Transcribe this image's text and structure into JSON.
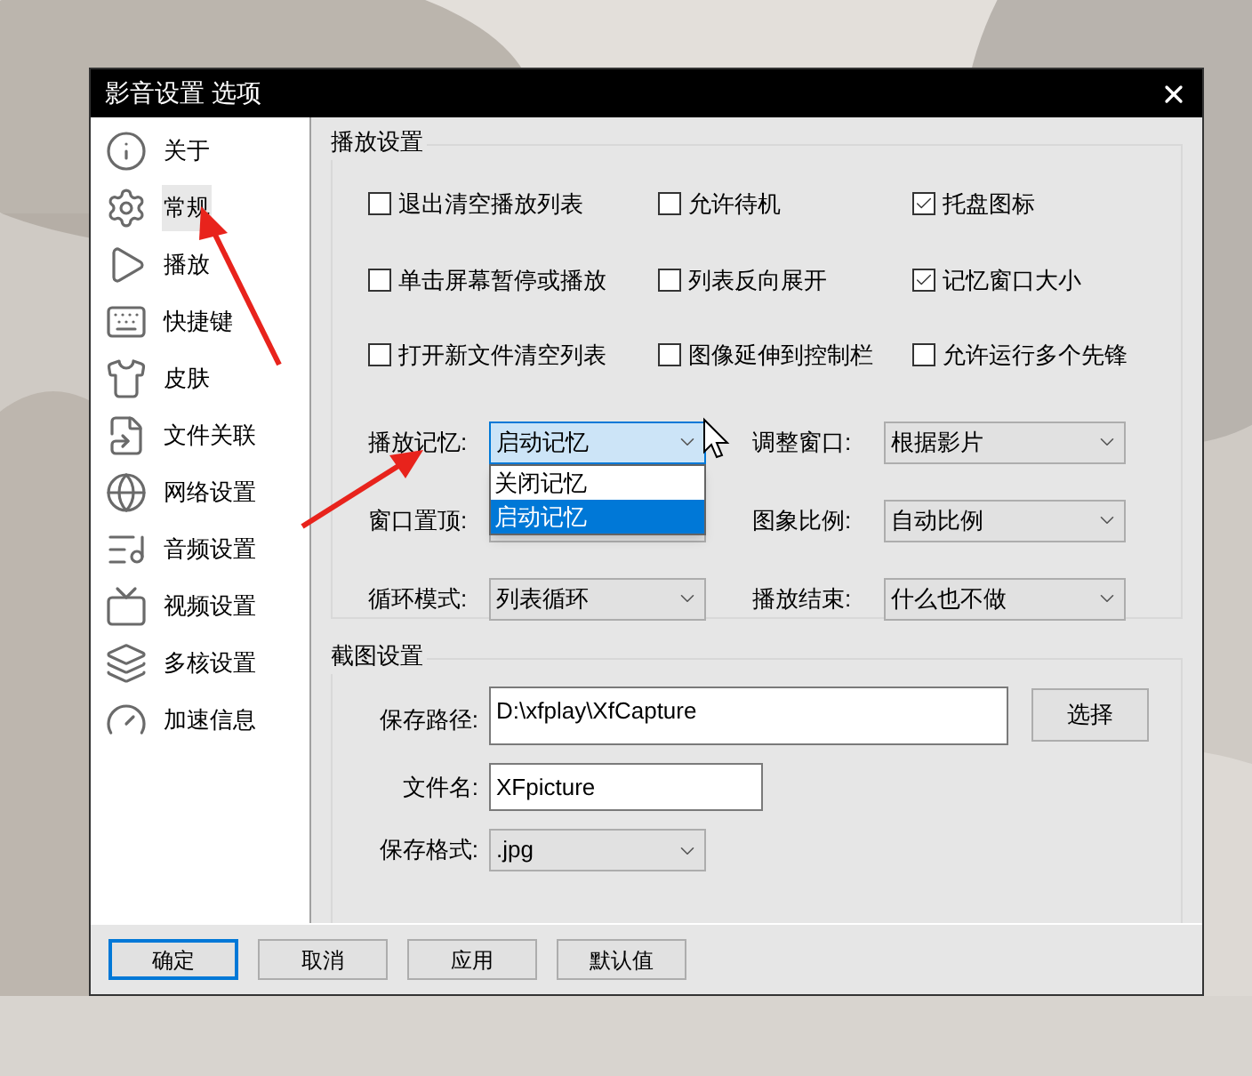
{
  "window": {
    "title": "影音设置 选项"
  },
  "sidebar": {
    "items": [
      {
        "label": "关于",
        "selected": false
      },
      {
        "label": "常规",
        "selected": true
      },
      {
        "label": "播放",
        "selected": false
      },
      {
        "label": "快捷键",
        "selected": false
      },
      {
        "label": "皮肤",
        "selected": false
      },
      {
        "label": "文件关联",
        "selected": false
      },
      {
        "label": "网络设置",
        "selected": false
      },
      {
        "label": "音频设置",
        "selected": false
      },
      {
        "label": "视频设置",
        "selected": false
      },
      {
        "label": "多核设置",
        "selected": false
      },
      {
        "label": "加速信息",
        "selected": false
      }
    ]
  },
  "playback": {
    "title": "播放设置",
    "options": [
      {
        "label": "退出清空播放列表",
        "checked": false
      },
      {
        "label": "允许待机",
        "checked": false
      },
      {
        "label": "托盘图标",
        "checked": true
      },
      {
        "label": "单击屏幕暂停或播放",
        "checked": false
      },
      {
        "label": "列表反向展开",
        "checked": false
      },
      {
        "label": "记忆窗口大小",
        "checked": true
      },
      {
        "label": "打开新文件清空列表",
        "checked": false
      },
      {
        "label": "图像延伸到控制栏",
        "checked": false
      },
      {
        "label": "允许运行多个先锋",
        "checked": false
      }
    ],
    "selects": [
      {
        "label": "播放记忆:",
        "value": "启动记忆",
        "open": true,
        "menu": [
          {
            "label": "关闭记忆",
            "selected": false
          },
          {
            "label": "启动记忆",
            "selected": true
          }
        ]
      },
      {
        "label": "调整窗口:",
        "value": "根据影片",
        "open": false
      },
      {
        "label": "窗口置顶:",
        "open": false
      },
      {
        "label": "图象比例:",
        "value": "自动比例",
        "open": false
      },
      {
        "label": "循环模式:",
        "value": "列表循环",
        "open": false
      },
      {
        "label": "播放结束:",
        "value": "什么也不做",
        "open": false
      }
    ]
  },
  "capture": {
    "title": "截图设置",
    "path": {
      "label": "保存路径:",
      "value": "D:\\xfplay\\XfCapture"
    },
    "choose_button": "选择",
    "filename": {
      "label": "文件名:",
      "value": "XFpicture"
    },
    "format": {
      "label": "保存格式:",
      "value": ".jpg"
    }
  },
  "buttons": [
    {
      "label": "确定",
      "focused": true
    },
    {
      "label": "取消",
      "focused": false
    },
    {
      "label": "应用",
      "focused": false
    },
    {
      "label": "默认值",
      "focused": false
    }
  ]
}
